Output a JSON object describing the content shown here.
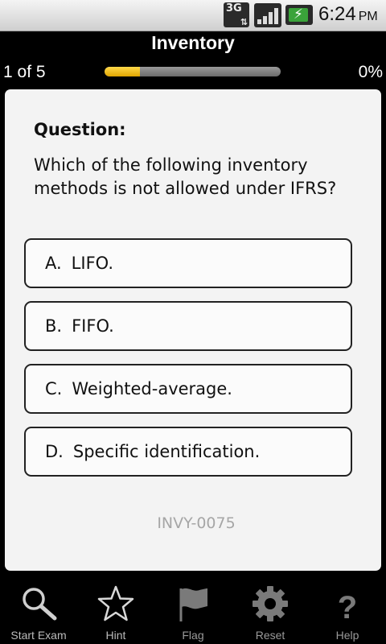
{
  "status_bar": {
    "network_label": "3G",
    "time": "6:24",
    "ampm": "PM",
    "icons": [
      "3g-data-icon",
      "signal-icon",
      "battery-charging-icon"
    ]
  },
  "header": {
    "title": "Inventory",
    "position": "1 of 5",
    "percent": "0%",
    "progress_fraction": 0.2,
    "progress_color": "#f0c010"
  },
  "question": {
    "label": "Question:",
    "text": "Which of the following inventory methods is not allowed under IFRS?",
    "answers": [
      {
        "letter": "A.",
        "text": "LIFO."
      },
      {
        "letter": "B.",
        "text": "FIFO."
      },
      {
        "letter": "C.",
        "text": "Weighted-average."
      },
      {
        "letter": "D.",
        "text": "Specific identification."
      }
    ],
    "id": "INVY-0075"
  },
  "bottom_bar": {
    "items": [
      {
        "label": "Start Exam",
        "icon": "magnifier-icon"
      },
      {
        "label": "Hint",
        "icon": "star-icon"
      },
      {
        "label": "Flag",
        "icon": "flag-icon"
      },
      {
        "label": "Reset",
        "icon": "gear-icon"
      },
      {
        "label": "Help",
        "icon": "question-icon"
      }
    ]
  }
}
